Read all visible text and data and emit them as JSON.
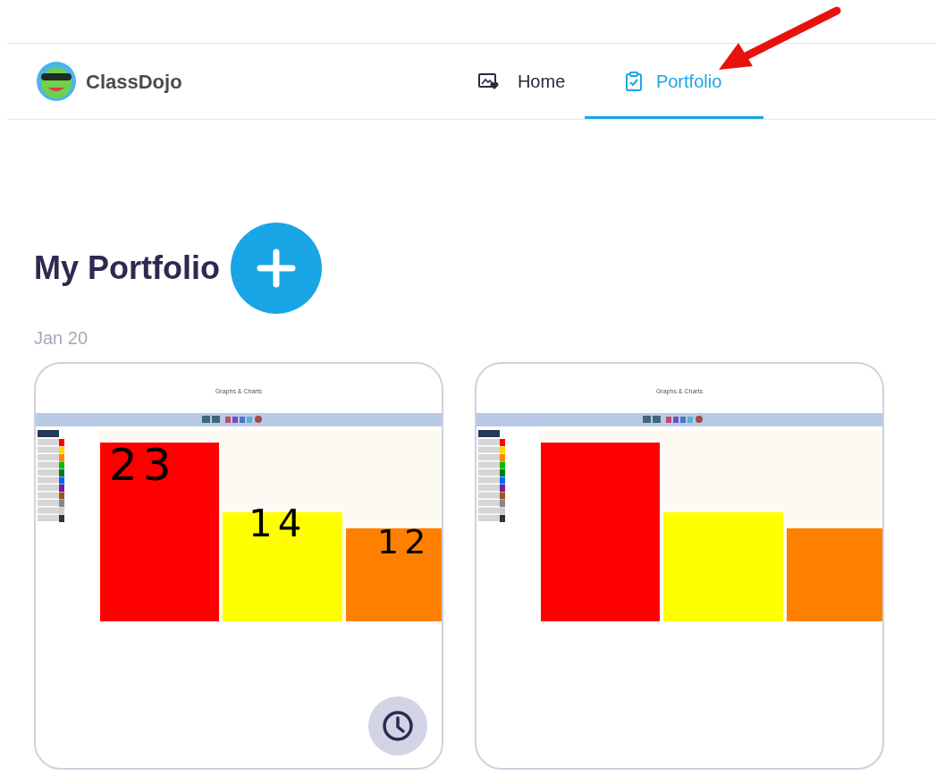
{
  "logo": {
    "text": "ClassDojo"
  },
  "nav_tabs": [
    {
      "label": "Home",
      "kind": "home",
      "selected": false
    },
    {
      "label": "Portfolio",
      "kind": "portfolio",
      "selected": true
    }
  ],
  "heading": "My Portfolio",
  "date": "Jan 20",
  "posts": [
    {
      "title": "Graphs & Charts",
      "annotations": [
        "23",
        "14",
        "12"
      ],
      "pending": true
    },
    {
      "title": "Graphs & Charts",
      "pending": false
    }
  ]
}
